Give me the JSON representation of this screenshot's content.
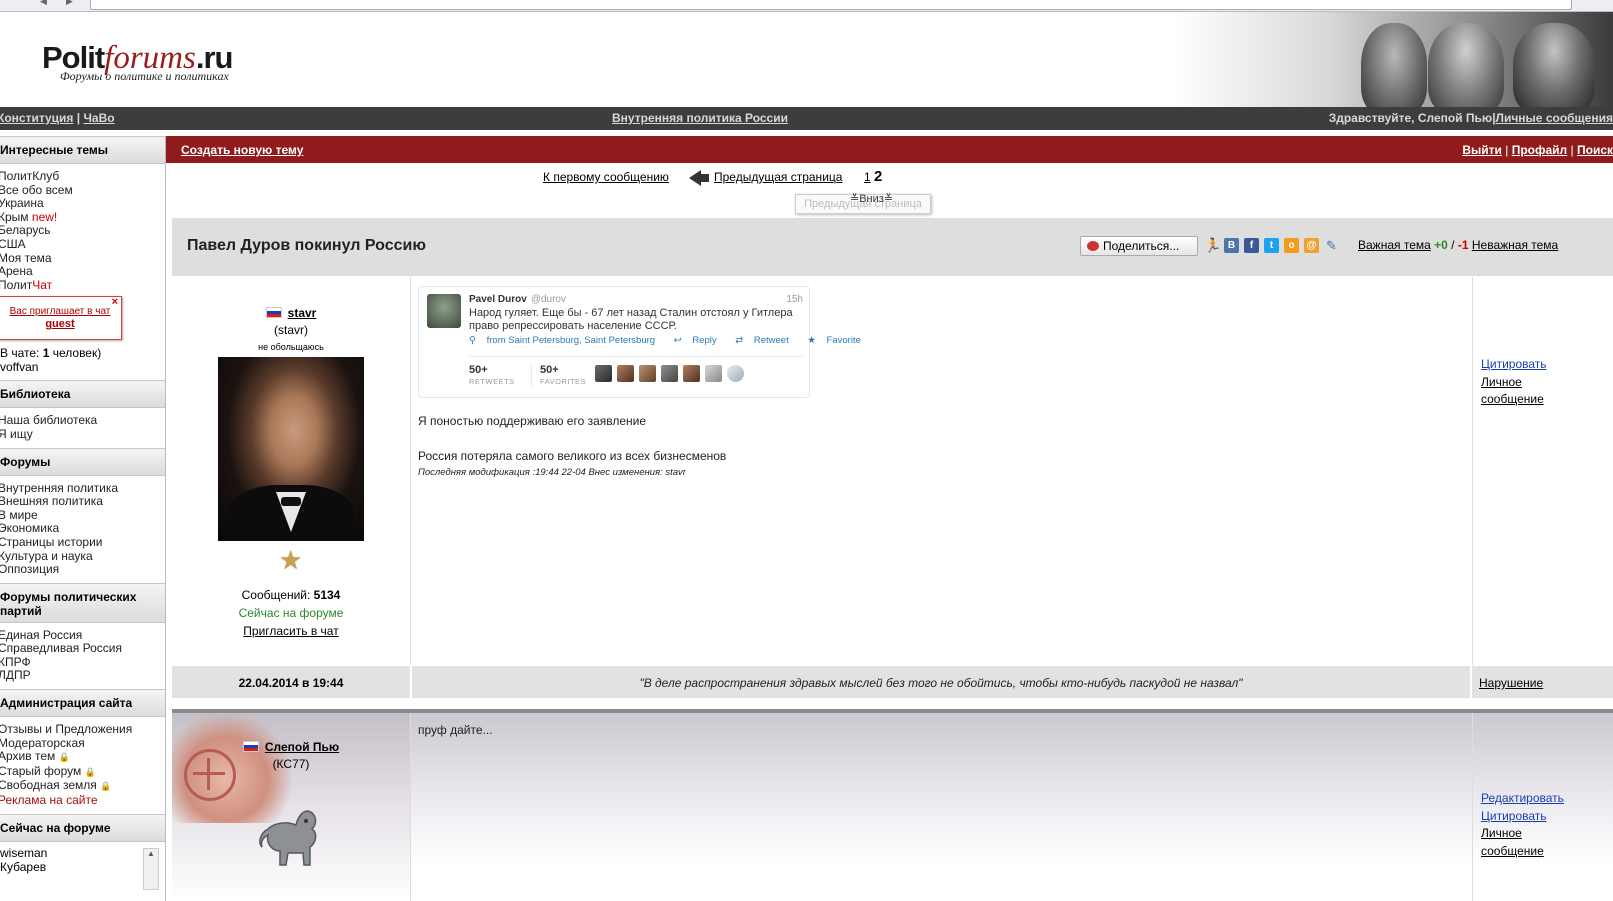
{
  "header": {
    "logo_main": "Polit",
    "logo_forums": "forums",
    "logo_ru": ".ru",
    "logo_tagline": "Форумы о политике и политиках"
  },
  "navbar": {
    "left_link1": "Конституция",
    "left_sep": " | ",
    "left_link2": "ЧаВо",
    "center": "Внутренняя политика России",
    "greeting": "Здравствуйте, Слепой Пью",
    "pm": "Личные сообщения"
  },
  "sidebar": {
    "interesting_head": "Интересные темы",
    "interesting": [
      "ПолитКлуб",
      "Все обо всем",
      "Украина",
      "Крым",
      "Беларусь",
      "США",
      "Моя тема",
      "Арена",
      "Полит"
    ],
    "crimea_new": "new!",
    "politchat_suffix": "Чат",
    "chat_invite": "Вас приглашает в чат",
    "chat_guest": "guest",
    "chat_close": "×",
    "in_chat_prefix": "В чате: ",
    "in_chat_count": "1",
    "in_chat_suffix": " человек)",
    "in_chat_user": "voffvan",
    "library_head": "Библиотека",
    "library": [
      "Наша библиотека",
      "Я ищу"
    ],
    "forums_head": "Форумы",
    "forums": [
      "Внутренняя политика",
      "Внешняя политика",
      "В мире",
      "Экономика",
      "Страницы истории",
      "Культура и наука",
      "Оппозиция"
    ],
    "parties_head": "Форумы политических партий",
    "parties": [
      "Единая Россия",
      "Справедливая Россия",
      "КПРФ",
      "ЛДПР"
    ],
    "admin_head": "Администрация сайта",
    "admin": [
      "Отзывы и Предложения",
      "Модераторская",
      "Архив тем",
      "Старый форум",
      "Свободная земля"
    ],
    "admin_ads": "Реклама на сайте",
    "online_head": "Сейчас на форуме",
    "online": [
      "wiseman",
      "Кубарев"
    ]
  },
  "redbar": {
    "new_topic": "Создать новую тему",
    "logout": "Выйти",
    "profile": "Профайл",
    "search": "Поиск"
  },
  "pager": {
    "first": "К первому сообщению",
    "prev": "Предыдущая страница",
    "page1": "1",
    "page2": "2",
    "tooltip": "Предыдущая страница",
    "down": "Вниз"
  },
  "topic": {
    "title": "Павел Дуров покинул Россию",
    "share": "Поделиться...",
    "important": "Важная тема",
    "plus": "+0",
    "slash": " / ",
    "minus": "-1",
    "unimportant": "Неважная тема"
  },
  "post1": {
    "username": "stavr",
    "login": "(stavr)",
    "status": "не обольщаюсь",
    "messages_label": "Сообщений: ",
    "messages_count": "5134",
    "online": "Сейчас на форуме",
    "invite": "Пригласить в чат",
    "tweet": {
      "name": "Pavel Durov",
      "handle": "@durov",
      "time": "15h",
      "text": "Народ гуляет. Еще бы - 67 лет назад Сталин отстоял у Гитлера право репрессировать население СССР.",
      "location": "from Saint Petersburg, Saint Petersburg",
      "reply": "Reply",
      "retweet": "Retweet",
      "favorite": "Favorite",
      "retweets_count": "50+",
      "retweets_label": "RETWEETS",
      "favorites_count": "50+",
      "favorites_label": "FAVORITES"
    },
    "text1": "Я поностью поддерживаю его заявление",
    "text2": "Россия потеряла самого великого из всех бизнесменов",
    "modified": "Последняя модификация :19:44 22-04 Внес изменения: stavr",
    "quote": "Цитировать",
    "pm1": "Личное",
    "pm2": "сообщение",
    "date": "22.04.2014 в 19:44",
    "signature": "\"В деле распространения здравых мыслей без того не обойтись, чтобы кто-нибудь паскудой не назвал\"",
    "report": "Нарушение"
  },
  "post2": {
    "username": "Слепой Пью",
    "login": "(КС77)",
    "text": "пруф дайте...",
    "edit": "Редактировать",
    "quote": "Цитировать",
    "pm1": "Личное",
    "pm2": "сообщение"
  },
  "colors": {
    "redbar": "#8f1b1d",
    "navbar": "#3d3d3d",
    "plus": "#2a8a2a",
    "minus": "#cc0000",
    "link_blue": "#1a3fb0"
  }
}
